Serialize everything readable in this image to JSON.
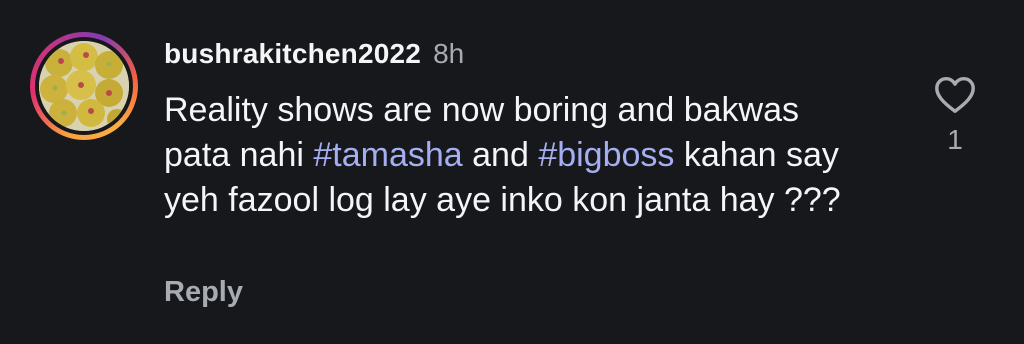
{
  "comment": {
    "author": "bushrakitchen2022",
    "time": "8h",
    "text_parts": [
      {
        "text": "Reality shows are now boring and bakwas pata nahi ",
        "type": "text"
      },
      {
        "text": "#tamasha",
        "type": "hashtag"
      },
      {
        "text": " and ",
        "type": "text"
      },
      {
        "text": "#bigboss",
        "type": "hashtag"
      },
      {
        "text": " kahan say yeh fazool log lay aye inko kon janta hay ???",
        "type": "text"
      }
    ],
    "reply_label": "Reply",
    "like_icon": "heart-outline-icon",
    "like_count": "1"
  },
  "colors": {
    "background": "#16181c",
    "text": "#f4f5f6",
    "muted": "#a8acb2",
    "hashtag": "#a6aef2"
  }
}
